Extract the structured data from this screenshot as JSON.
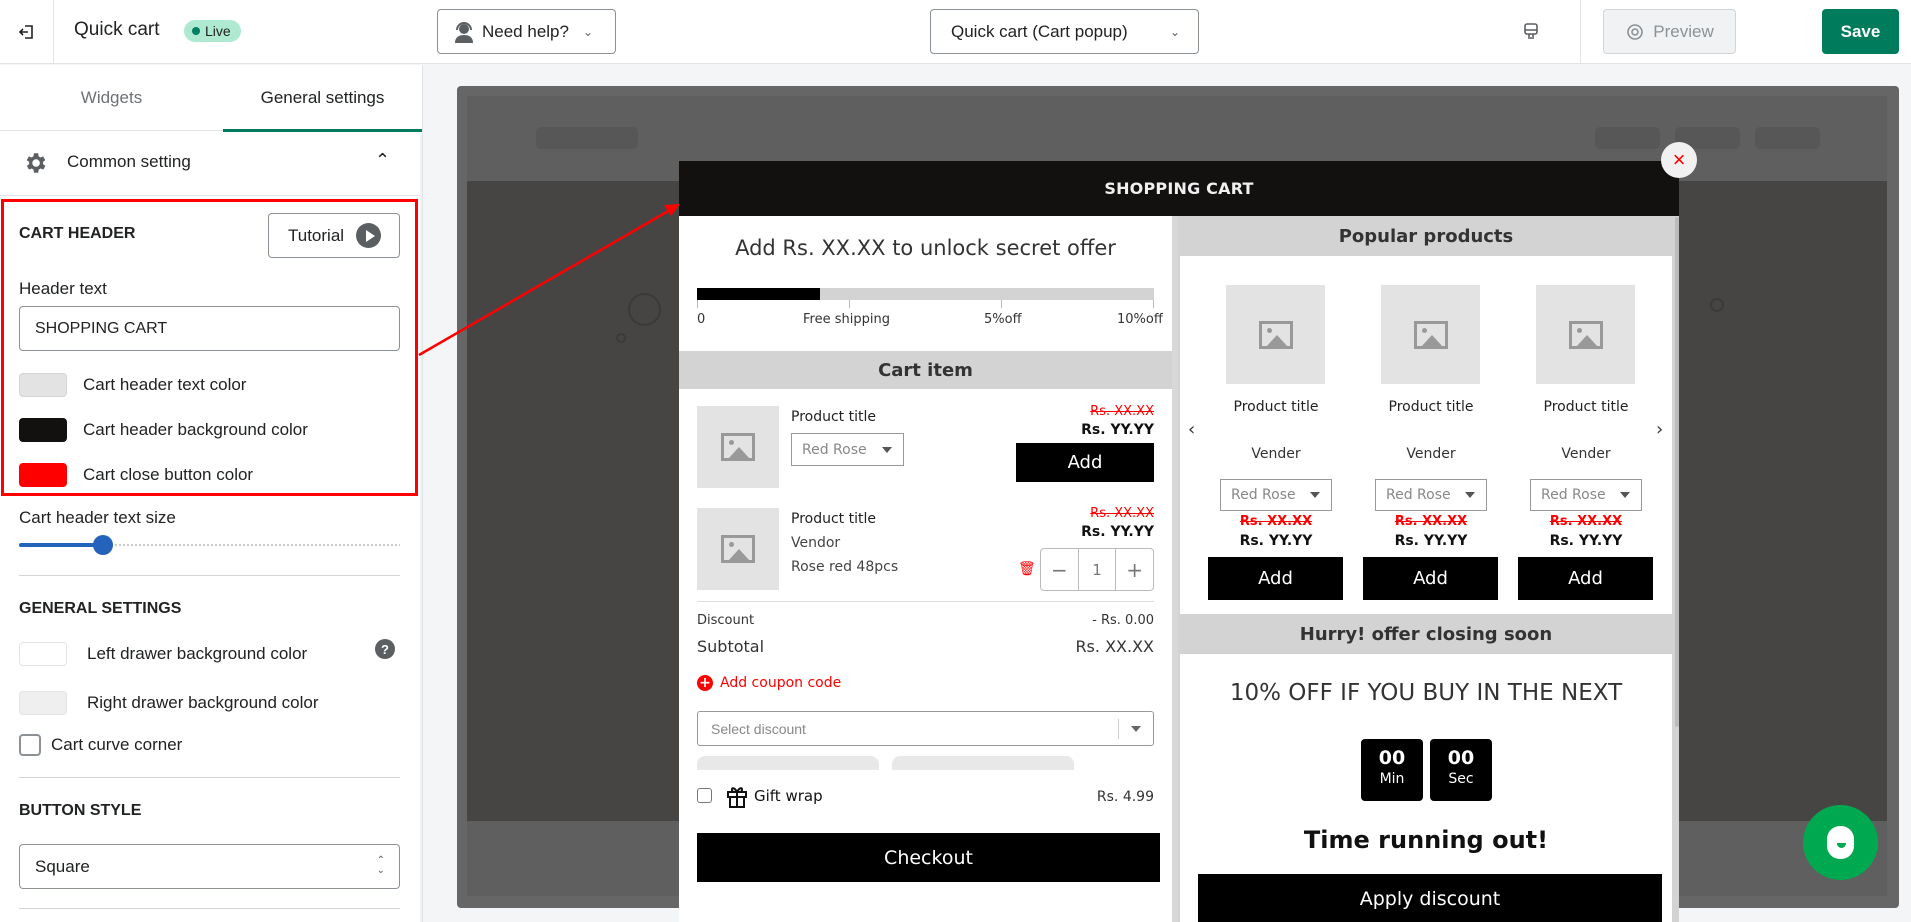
{
  "topbar": {
    "exit_icon": "exit-icon",
    "app_title": "Quick cart",
    "status_badge": "Live",
    "help_button": "Need help?",
    "help_icon": "support-agent-icon",
    "template_select": "Quick cart (Cart popup)",
    "device_icon": "desktop-icon",
    "preview_button": "Preview",
    "preview_icon": "eye-icon",
    "save_button": "Save"
  },
  "sidebar": {
    "tabs": [
      {
        "label": "Widgets",
        "active": false
      },
      {
        "label": "General settings",
        "active": true
      }
    ],
    "common_setting": {
      "label": "Common setting",
      "icon": "gear-icon",
      "expanded": true
    },
    "cart_header": {
      "title": "CART HEADER",
      "tutorial_button": "Tutorial",
      "header_text_label": "Header text",
      "header_text_value": "SHOPPING CART",
      "colors": [
        {
          "label": "Cart header text color",
          "value": "#e3e3e3"
        },
        {
          "label": "Cart header background color",
          "value": "#131110"
        },
        {
          "label": "Cart close button color",
          "value": "#ff0000"
        }
      ],
      "text_size_label": "Cart header text size",
      "text_size_fraction": 0.22
    },
    "general_settings": {
      "title": "GENERAL SETTINGS",
      "colors": [
        {
          "label": "Left drawer background color",
          "value": "#ffffff"
        },
        {
          "label": "Right drawer background color",
          "value": "#efefef"
        }
      ],
      "help_icon": "?",
      "curve_corner_label": "Cart curve corner",
      "curve_corner_checked": false
    },
    "button_style": {
      "title": "BUTTON STYLE",
      "selected": "Square"
    }
  },
  "cart": {
    "header": "SHOPPING CART",
    "close_icon": "×",
    "offer_text": "Add Rs. XX.XX to unlock secret offer",
    "progress_fraction": 0.27,
    "milestones": [
      "0",
      "Free shipping",
      "5%off",
      "10%off"
    ],
    "cart_item_heading": "Cart item",
    "items": [
      {
        "title": "Product title",
        "variant": "Red Rose",
        "old_price": "Rs. XX.XX",
        "new_price": "Rs. YY.YY",
        "action": "Add"
      },
      {
        "title": "Product title",
        "vendor": "Vendor",
        "variant_text": "Rose red 48pcs",
        "old_price": "Rs. XX.XX",
        "new_price": "Rs. YY.YY",
        "quantity": "1",
        "minus": "−",
        "plus": "+"
      }
    ],
    "discount_label": "Discount",
    "discount_value": "- Rs. 0.00",
    "subtotal_label": "Subtotal",
    "subtotal_value": "Rs. XX.XX",
    "coupon_link": "Add coupon code",
    "discount_placeholder": "Select discount",
    "gift_wrap_label": "Gift wrap",
    "gift_wrap_price": "Rs. 4.99",
    "checkout_button": "Checkout",
    "popular": {
      "heading": "Popular products",
      "prev": "‹",
      "next": "›",
      "products": [
        {
          "title": "Product title",
          "vendor": "Vender",
          "variant": "Red Rose",
          "old_price": "Rs. XX.XX",
          "new_price": "Rs. YY.YY",
          "action": "Add"
        },
        {
          "title": "Product title",
          "vendor": "Vender",
          "variant": "Red Rose",
          "old_price": "Rs. XX.XX",
          "new_price": "Rs. YY.YY",
          "action": "Add"
        },
        {
          "title": "Product title",
          "vendor": "Vender",
          "variant": "Red Rose",
          "old_price": "Rs. XX.XX",
          "new_price": "Rs. YY.YY",
          "action": "Add"
        }
      ]
    },
    "timer": {
      "heading": "Hurry! offer closing soon",
      "title": "10% OFF IF YOU BUY IN THE NEXT",
      "minutes": "00",
      "minutes_label": "Min",
      "seconds": "00",
      "seconds_label": "Sec",
      "message": "Time running out!",
      "apply_button": "Apply discount"
    }
  },
  "chat": {
    "icon": "chat-icon"
  }
}
